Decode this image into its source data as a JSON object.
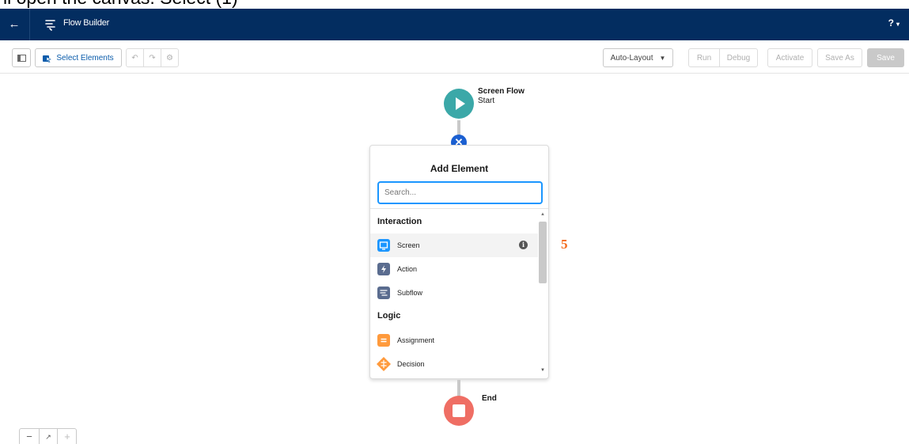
{
  "caption": "il open the canvas. Select (1)",
  "app": {
    "title": "Flow Builder",
    "help_label": "?"
  },
  "toolbar": {
    "select_elements": "Select Elements",
    "layout": "Auto-Layout",
    "run": "Run",
    "debug": "Debug",
    "activate": "Activate",
    "save_as": "Save As",
    "save": "Save"
  },
  "canvas": {
    "start": {
      "title": "Screen Flow",
      "subtitle": "Start"
    },
    "end": {
      "label": "End"
    },
    "annotation": "5"
  },
  "add_element": {
    "title": "Add Element",
    "search_placeholder": "Search...",
    "sections": [
      {
        "label": "Interaction",
        "items": [
          {
            "label": "Screen",
            "icon": "screen-icon",
            "color": "#1b96ff"
          },
          {
            "label": "Action",
            "icon": "action-icon",
            "color": "#5a6c8f"
          },
          {
            "label": "Subflow",
            "icon": "subflow-icon",
            "color": "#5a6c8f"
          }
        ]
      },
      {
        "label": "Logic",
        "items": [
          {
            "label": "Assignment",
            "icon": "assignment-icon",
            "color": "#ff9a3c"
          },
          {
            "label": "Decision",
            "icon": "decision-icon",
            "color": "#ff9a3c"
          }
        ]
      }
    ]
  },
  "colors": {
    "header": "#032d60",
    "start": "#3ba8a8",
    "end": "#ef6e64",
    "accent": "#1b5fd1",
    "annotation": "#f46a1b"
  }
}
